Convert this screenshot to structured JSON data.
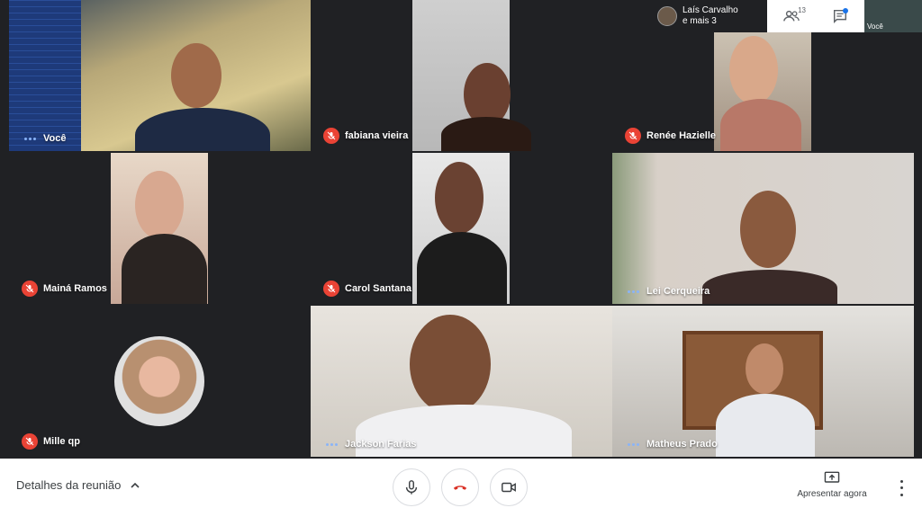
{
  "presenter": {
    "line1": "Laís Carvalho",
    "line2": "e mais 3"
  },
  "people_count": "13",
  "self_mini_label": "Você",
  "participants": [
    {
      "name": "Você",
      "muted": false
    },
    {
      "name": "fabiana vieira",
      "muted": true
    },
    {
      "name": "Renée Hazielle",
      "muted": true
    },
    {
      "name": "Mainá Ramos",
      "muted": true
    },
    {
      "name": "Carol Santana",
      "muted": true
    },
    {
      "name": "Lei Cerqueira",
      "muted": false
    },
    {
      "name": "Mille qp",
      "muted": true
    },
    {
      "name": "Jackson Farias",
      "muted": false
    },
    {
      "name": "Matheus Prado",
      "muted": false
    }
  ],
  "bottom": {
    "details_label": "Detalhes da reunião",
    "present_label": "Apresentar agora"
  },
  "colors": {
    "mute_red": "#ea4335",
    "speaking_blue": "#8ab4f8",
    "hangup_red": "#d93025"
  }
}
